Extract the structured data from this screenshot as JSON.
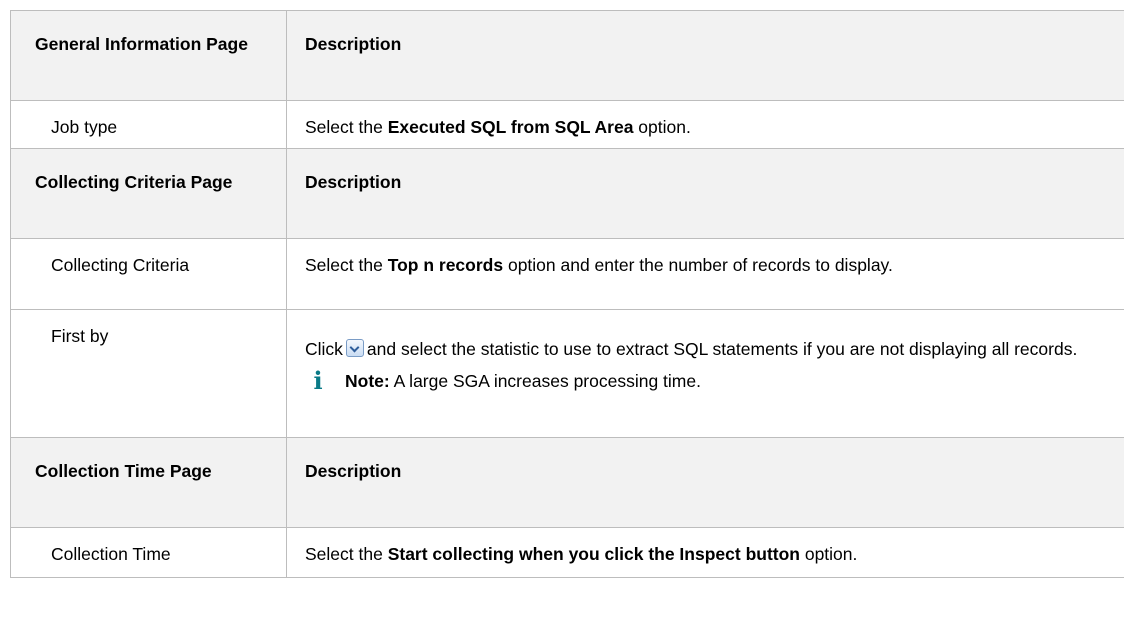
{
  "table": {
    "section1": {
      "header_left": "General Information Page",
      "header_right": "Description",
      "rows": [
        {
          "label": "Job type",
          "pre": "Select the ",
          "bold": "Executed SQL from SQL Area",
          "post": " option."
        }
      ]
    },
    "section2": {
      "header_left": "Collecting Criteria Page",
      "header_right": "Description",
      "row1": {
        "label": "Collecting Criteria",
        "pre": "Select the ",
        "bold": "Top n records",
        "post": " option and enter the number of records to display."
      },
      "row2": {
        "label": "First by",
        "pre": "Click",
        "icon": "dropdown-arrow-icon",
        "post": "and select the statistic to use to extract SQL statements if you are not displaying all records.",
        "note_icon": "info-icon",
        "note_glyph": "i",
        "note_bold": "Note:",
        "note_text": " A large SGA increases processing time."
      }
    },
    "section3": {
      "header_left": "Collection Time Page",
      "header_right": "Description",
      "row1": {
        "label": "Collection Time",
        "pre": "Select the ",
        "bold": "Start collecting when you click the Inspect button",
        "post": " option."
      }
    }
  }
}
